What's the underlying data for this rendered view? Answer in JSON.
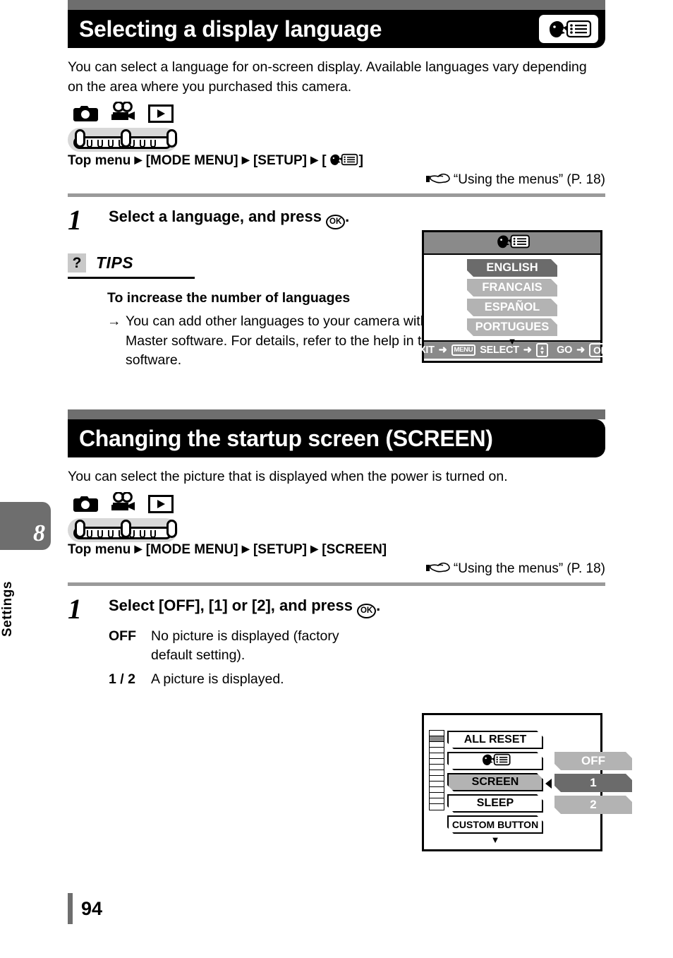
{
  "sidebar": {
    "chapter_number": "8",
    "chapter_label": "Settings"
  },
  "page_number": "94",
  "sections": [
    {
      "title": "Selecting a display language",
      "icon": "language-icon",
      "intro": "You can select a language for on-screen display. Available languages vary depending on the area where you purchased this camera.",
      "modes": [
        "camera-icon",
        "movie-icon",
        "playback-icon"
      ],
      "breadcrumb_prefix": "Top menu",
      "breadcrumb": [
        "[MODE MENU]",
        "[SETUP]"
      ],
      "breadcrumb_last": "[",
      "breadcrumb_last_end": "]",
      "reference": "“Using the menus” (P. 18)",
      "step_number": "1",
      "step_title_pre": "Select a language, and press ",
      "step_title_post": "."
    },
    {
      "title": "Changing the startup screen (SCREEN)",
      "intro": "You can select the picture that is displayed when the power is turned on.",
      "modes": [
        "camera-icon",
        "movie-icon",
        "playback-icon"
      ],
      "breadcrumb_prefix": "Top menu",
      "breadcrumb": [
        "[MODE MENU]",
        "[SETUP]",
        "[SCREEN]"
      ],
      "reference": "“Using the menus” (P. 18)",
      "step_number": "1",
      "step_title_pre": "Select [OFF], [1] or [2], and press ",
      "step_title_post": ".",
      "definitions": [
        {
          "key": "OFF",
          "value": "No picture is displayed (factory default setting)."
        },
        {
          "key": "1 / 2",
          "value": "A picture is displayed."
        }
      ]
    }
  ],
  "tips": {
    "icon": "question-icon",
    "label": "TIPS",
    "subtitle": "To increase the number of languages",
    "arrow": "→",
    "body": "You can add other languages to your camera with the provided OLYMPUS Master software. For details, refer to the help in the OLYMPUS Master software."
  },
  "lcd_language": {
    "title_icon": "language-icon",
    "items": [
      {
        "label": "ENGLISH",
        "selected": true
      },
      {
        "label": "FRANCAIS",
        "selected": false
      },
      {
        "label": "ESPAÑOL",
        "selected": false
      },
      {
        "label": "PORTUGUES",
        "selected": false
      }
    ],
    "more_caret": "▼",
    "statusbar": {
      "exit_label": "EXIT",
      "exit_arrow": "➜",
      "menu_key": "MENU",
      "select_label": "SELECT",
      "select_arrow": "➜",
      "updown_up": "▲",
      "updown_down": "▼",
      "go_label": "GO",
      "go_arrow": "➜",
      "ok_key": "OK"
    }
  },
  "lcd_screen": {
    "left_items": [
      {
        "label": "ALL RESET",
        "selected": false,
        "small": false
      },
      {
        "label": "",
        "icon": "language-icon",
        "selected": false,
        "small": false
      },
      {
        "label": "SCREEN",
        "selected": true,
        "small": false
      },
      {
        "label": "SLEEP",
        "selected": false,
        "small": false
      },
      {
        "label": "CUSTOM BUTTON",
        "selected": false,
        "small": true
      }
    ],
    "more_caret": "▼",
    "values": [
      {
        "label": "OFF",
        "selected": false
      },
      {
        "label": "1",
        "selected": true
      },
      {
        "label": "2",
        "selected": false
      }
    ],
    "scroll_total": 14,
    "scroll_active_index": 1
  },
  "glyphs": {
    "ok_button": "OK",
    "arrow_right": "▶",
    "pointing_hand": "☞"
  }
}
